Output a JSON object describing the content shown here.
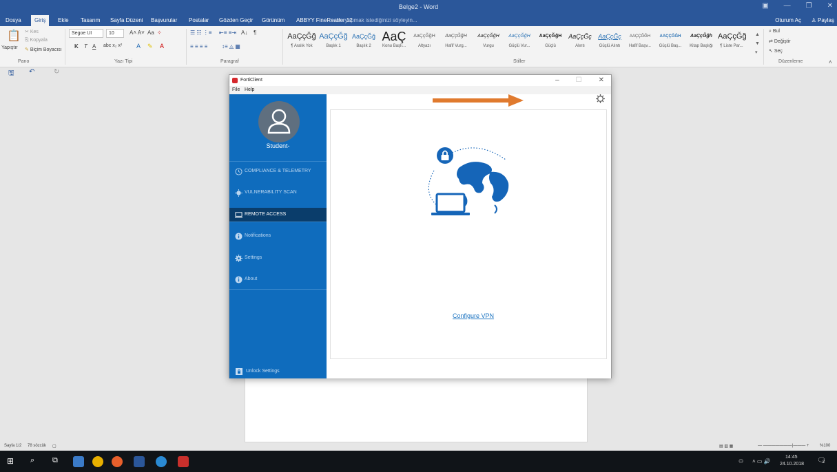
{
  "word": {
    "title": "Belge2 - Word",
    "tabs": [
      "Dosya",
      "Giriş",
      "Ekle",
      "Tasarım",
      "Sayfa Düzeni",
      "Başvurular",
      "Postalar",
      "Gözden Geçir",
      "Görünüm",
      "ABBYY FineReader 12"
    ],
    "active_tab": "Giriş",
    "tell_me": "Ne yapmak istediğinizi söyleyin...",
    "sign_in": "Oturum Aç",
    "share": "Paylaş",
    "ribbon": {
      "paste": "Yapıştır",
      "cut": "Kes",
      "copy": "Kopyala",
      "format_painter": "Biçim Boyacısı",
      "font_name": "Segoe UI",
      "font_size": "10",
      "case": "Aa",
      "groups": [
        "Pano",
        "Yazı Tipi",
        "Paragraf",
        "Stiller",
        "Düzenleme"
      ],
      "styles": [
        {
          "sample": "AaÇçĞğ",
          "name": "¶ Aralık Yok"
        },
        {
          "sample": "AaÇçĞğ",
          "name": "Başlık 1"
        },
        {
          "sample": "AaÇçĞğ",
          "name": "Başlık 2"
        },
        {
          "sample": "AaÇ",
          "name": "Konu Başlı..."
        },
        {
          "sample": "AaÇçĞğH",
          "name": "Altyazı"
        },
        {
          "sample": "AaÇçĞğH",
          "name": "Hafif Vurg..."
        },
        {
          "sample": "AaÇçĞğH",
          "name": "Vurgu"
        },
        {
          "sample": "AaÇçĞğH",
          "name": "Güçlü Vur..."
        },
        {
          "sample": "AaÇçĞğH",
          "name": "Güçlü"
        },
        {
          "sample": "AaÇçĞç",
          "name": "Alıntı"
        },
        {
          "sample": "AaÇçĞç",
          "name": "Güçlü Alıntı"
        },
        {
          "sample": "AAÇÇĞĞH",
          "name": "Hafif Başv..."
        },
        {
          "sample": "AAÇÇĞĞH",
          "name": "Güçlü Baş..."
        },
        {
          "sample": "AaÇçĞğh",
          "name": "Kitap Başlığı"
        },
        {
          "sample": "AaÇçĞğ",
          "name": "¶ Liste Par..."
        }
      ],
      "find": "Bul",
      "replace": "Değiştir",
      "select": "Seç"
    },
    "status": {
      "page": "Sayfa 1/2",
      "words": "78 sözcük",
      "zoom": "%100"
    }
  },
  "taskbar": {
    "time": "14:45",
    "date": "24.10.2018",
    "notification_count": "2"
  },
  "forticlient": {
    "title": "FortiClient",
    "menu": [
      "File",
      "Help"
    ],
    "username": "Student-",
    "nav": [
      {
        "label": "COMPLIANCE & TELEMETRY",
        "icon": "compliance-icon",
        "active": false
      },
      {
        "label": "VULNERABILITY SCAN",
        "icon": "scan-icon",
        "active": false
      },
      {
        "label": "REMOTE ACCESS",
        "icon": "remote-access-icon",
        "active": true
      },
      {
        "label": "Notifications",
        "icon": "info-icon",
        "active": false
      },
      {
        "label": "Settings",
        "icon": "settings-icon",
        "active": false
      },
      {
        "label": "About",
        "icon": "about-icon",
        "active": false
      }
    ],
    "unlock_settings": "Unlock Settings",
    "configure_vpn": "Configure VPN",
    "colors": {
      "sidebar": "#0f6cbd",
      "sidebar_active": "#0a3d6b",
      "illustration": "#1565b8",
      "annotation_arrow": "#e07a2e"
    }
  }
}
